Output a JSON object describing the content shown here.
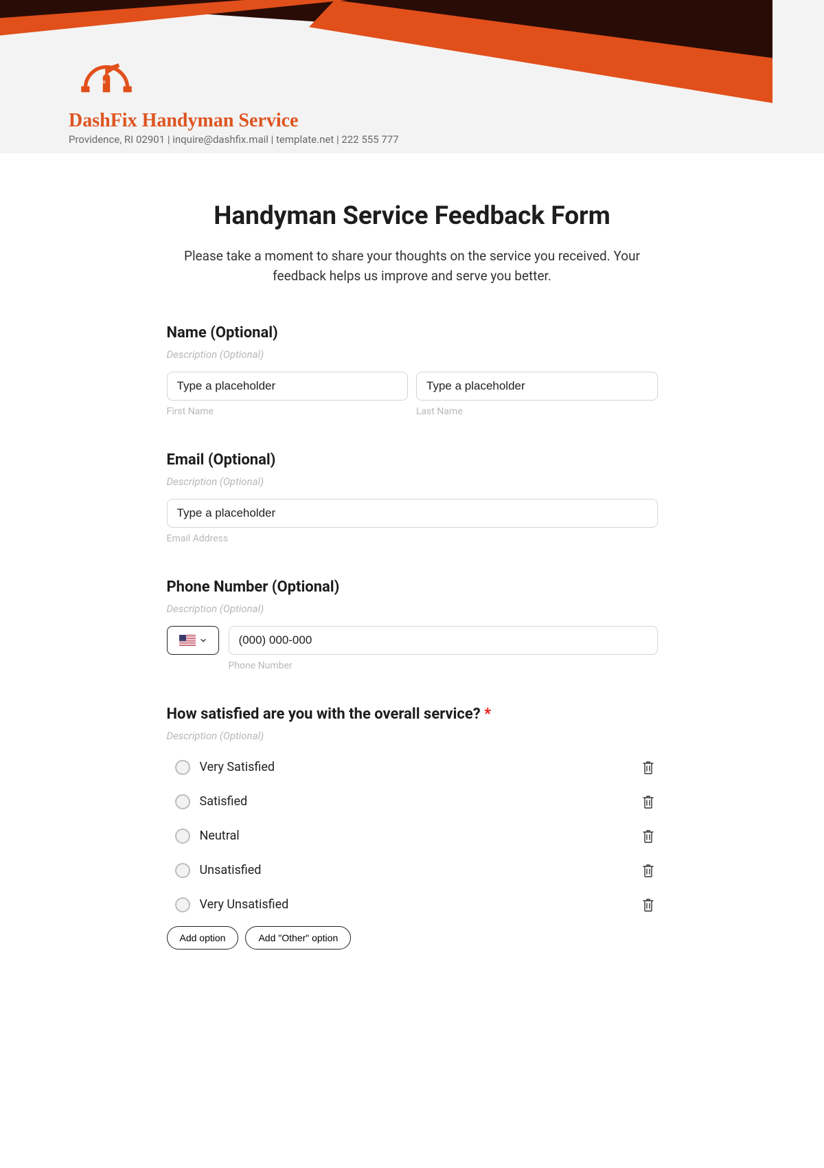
{
  "brand": {
    "name": "DashFix Handyman Service",
    "subline": "Providence, RI 02901 | inquire@dashfix.mail | template.net | 222 555 777"
  },
  "form": {
    "title": "Handyman Service Feedback Form",
    "intro": "Please take a moment to share your thoughts on the service you received. Your feedback helps us improve and serve you better."
  },
  "fields": {
    "name": {
      "label": "Name (Optional)",
      "desc": "Description (Optional)",
      "first_placeholder": "Type a placeholder",
      "first_sub": "First Name",
      "last_placeholder": "Type a placeholder",
      "last_sub": "Last Name"
    },
    "email": {
      "label": "Email (Optional)",
      "desc": "Description (Optional)",
      "placeholder": "Type a placeholder",
      "sub": "Email Address"
    },
    "phone": {
      "label": "Phone Number (Optional)",
      "desc": "Description (Optional)",
      "placeholder": "(000) 000-000",
      "sub": "Phone Number"
    },
    "satisfaction": {
      "label": "How satisfied are you with the overall service? ",
      "required_mark": "*",
      "desc": "Description (Optional)",
      "options": [
        "Very Satisfied",
        "Satisfied",
        "Neutral",
        "Unsatisfied",
        "Very Unsatisfied"
      ],
      "add_option": "Add option",
      "add_other": "Add \"Other\" option"
    }
  },
  "colors": {
    "accent": "#de5420",
    "dark": "#2a0c06"
  }
}
